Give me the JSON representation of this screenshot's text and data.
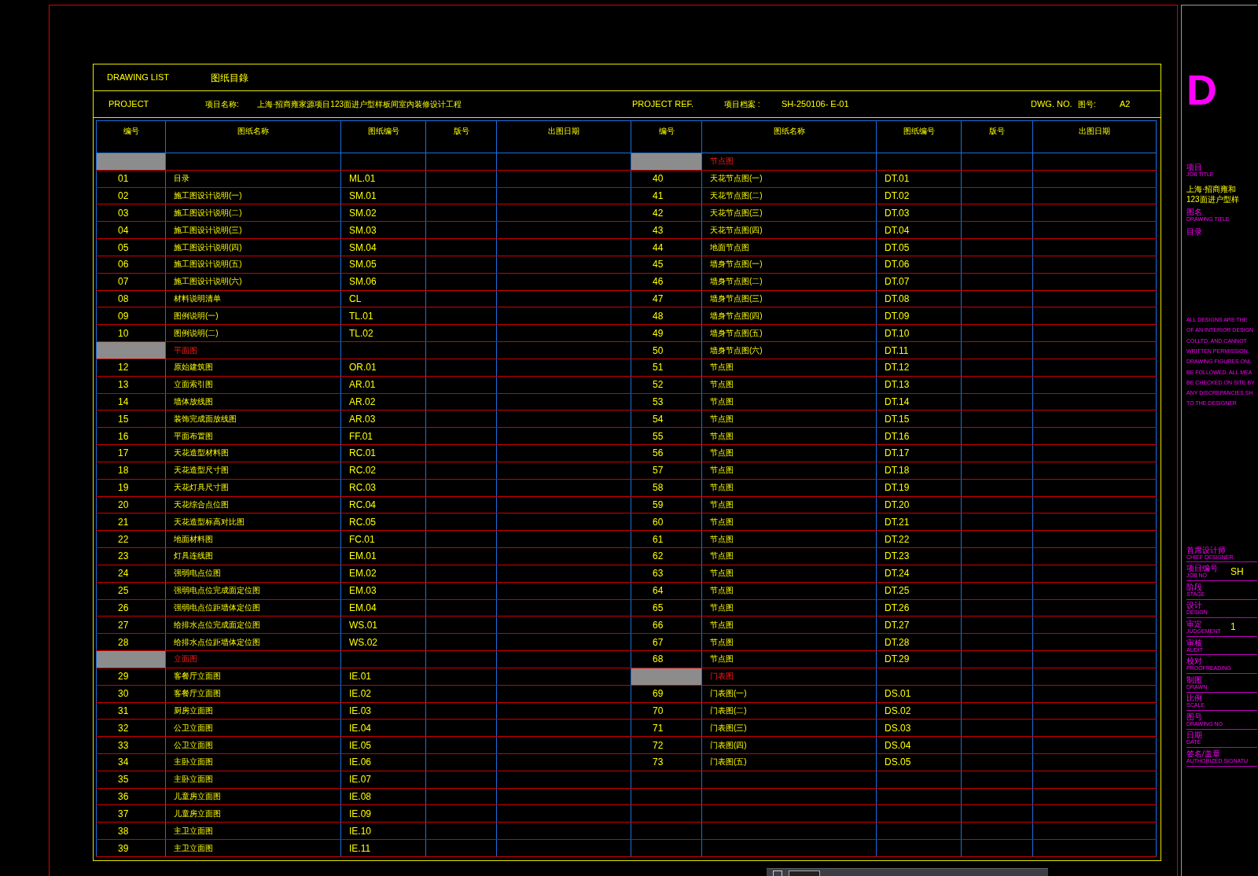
{
  "header": {
    "title_en": "DRAWING LIST",
    "title_cn": "图纸目錄"
  },
  "project": {
    "label_en": "PROJECT",
    "label_cn": "项目名称:",
    "name": "上海·招商雍家源项目123面进户型样板间室内装修设计工程",
    "ref_label_en": "PROJECT REF.",
    "ref_label_cn": "项目档案 :",
    "ref": "SH-250106- E-01",
    "dwg_label_en": "DWG. NO.",
    "dwg_label_cn": "图号:",
    "dwg_no": "A2"
  },
  "left_columns": [
    "编号",
    "图纸名称",
    "图纸编号",
    "版号",
    "出图日期"
  ],
  "right_columns": [
    "编号",
    "图纸名称",
    "图纸编号",
    "版号",
    "出图日期"
  ],
  "left_rows": [
    {
      "kind": "section"
    },
    {
      "kind": "sheet",
      "number": "01",
      "name": "目录",
      "code": "ML.01"
    },
    {
      "kind": "sheet",
      "number": "02",
      "name": "施工图设计说明(一)",
      "code": "SM.01"
    },
    {
      "kind": "sheet",
      "number": "03",
      "name": "施工图设计说明(二)",
      "code": "SM.02"
    },
    {
      "kind": "sheet",
      "number": "04",
      "name": "施工图设计说明(三)",
      "code": "SM.03"
    },
    {
      "kind": "sheet",
      "number": "05",
      "name": "施工图设计说明(四)",
      "code": "SM.04"
    },
    {
      "kind": "sheet",
      "number": "06",
      "name": "施工图设计说明(五)",
      "code": "SM.05"
    },
    {
      "kind": "sheet",
      "number": "07",
      "name": "施工图设计说明(六)",
      "code": "SM.06"
    },
    {
      "kind": "sheet",
      "number": "08",
      "name": "材料说明清单",
      "code": "CL"
    },
    {
      "kind": "sheet",
      "number": "09",
      "name": "图例说明(一)",
      "code": "TL.01"
    },
    {
      "kind": "sheet",
      "number": "10",
      "name": "图例说明(二)",
      "code": "TL.02"
    },
    {
      "kind": "section",
      "name": "平面图"
    },
    {
      "kind": "sheet",
      "number": "12",
      "name": "原始建筑图",
      "code": "OR.01"
    },
    {
      "kind": "sheet",
      "number": "13",
      "name": "立面索引图",
      "code": "AR.01"
    },
    {
      "kind": "sheet",
      "number": "14",
      "name": "墙体放线图",
      "code": "AR.02"
    },
    {
      "kind": "sheet",
      "number": "15",
      "name": "装饰完成面放线图",
      "code": "AR.03"
    },
    {
      "kind": "sheet",
      "number": "16",
      "name": "平面布置图",
      "code": "FF.01"
    },
    {
      "kind": "sheet",
      "number": "17",
      "name": "天花造型材料图",
      "code": "RC.01"
    },
    {
      "kind": "sheet",
      "number": "18",
      "name": "天花造型尺寸图",
      "code": "RC.02"
    },
    {
      "kind": "sheet",
      "number": "19",
      "name": "天花灯具尺寸图",
      "code": "RC.03"
    },
    {
      "kind": "sheet",
      "number": "20",
      "name": "天花综合点位图",
      "code": "RC.04"
    },
    {
      "kind": "sheet",
      "number": "21",
      "name": "天花造型标高对比图",
      "code": "RC.05"
    },
    {
      "kind": "sheet",
      "number": "22",
      "name": "地面材料图",
      "code": "FC.01"
    },
    {
      "kind": "sheet",
      "number": "23",
      "name": "灯具连线图",
      "code": "EM.01"
    },
    {
      "kind": "sheet",
      "number": "24",
      "name": "强弱电点位图",
      "code": "EM.02"
    },
    {
      "kind": "sheet",
      "number": "25",
      "name": "强弱电点位完成面定位图",
      "code": "EM.03"
    },
    {
      "kind": "sheet",
      "number": "26",
      "name": "强弱电点位距墙体定位图",
      "code": "EM.04"
    },
    {
      "kind": "sheet",
      "number": "27",
      "name": "给排水点位完成面定位图",
      "code": "WS.01"
    },
    {
      "kind": "sheet",
      "number": "28",
      "name": "给排水点位距墙体定位图",
      "code": "WS.02"
    },
    {
      "kind": "section",
      "name": "立面图"
    },
    {
      "kind": "sheet",
      "number": "29",
      "name": "客餐厅立面图",
      "code": "IE.01"
    },
    {
      "kind": "sheet",
      "number": "30",
      "name": "客餐厅立面图",
      "code": "IE.02"
    },
    {
      "kind": "sheet",
      "number": "31",
      "name": "厨房立面图",
      "code": "IE.03"
    },
    {
      "kind": "sheet",
      "number": "32",
      "name": "公卫立面图",
      "code": "IE.04"
    },
    {
      "kind": "sheet",
      "number": "33",
      "name": "公卫立面图",
      "code": "IE.05"
    },
    {
      "kind": "sheet",
      "number": "34",
      "name": "主卧立面图",
      "code": "IE.06"
    },
    {
      "kind": "sheet",
      "number": "35",
      "name": "主卧立面图",
      "code": "IE.07"
    },
    {
      "kind": "sheet",
      "number": "36",
      "name": "儿童房立面图",
      "code": "IE.08"
    },
    {
      "kind": "sheet",
      "number": "37",
      "name": "儿童房立面图",
      "code": "IE.09"
    },
    {
      "kind": "sheet",
      "number": "38",
      "name": "主卫立面图",
      "code": "IE.10"
    },
    {
      "kind": "sheet",
      "number": "39",
      "name": "主卫立面图",
      "code": "IE.11"
    }
  ],
  "right_rows": [
    {
      "kind": "section",
      "name": "节点图"
    },
    {
      "kind": "sheet",
      "number": "40",
      "name": "天花节点图(一)",
      "code": "DT.01"
    },
    {
      "kind": "sheet",
      "number": "41",
      "name": "天花节点图(二)",
      "code": "DT.02"
    },
    {
      "kind": "sheet",
      "number": "42",
      "name": "天花节点图(三)",
      "code": "DT.03"
    },
    {
      "kind": "sheet",
      "number": "43",
      "name": "天花节点图(四)",
      "code": "DT.04"
    },
    {
      "kind": "sheet",
      "number": "44",
      "name": "地面节点图",
      "code": "DT.05"
    },
    {
      "kind": "sheet",
      "number": "45",
      "name": "墙身节点图(一)",
      "code": "DT.06"
    },
    {
      "kind": "sheet",
      "number": "46",
      "name": "墙身节点图(二)",
      "code": "DT.07"
    },
    {
      "kind": "sheet",
      "number": "47",
      "name": "墙身节点图(三)",
      "code": "DT.08"
    },
    {
      "kind": "sheet",
      "number": "48",
      "name": "墙身节点图(四)",
      "code": "DT.09"
    },
    {
      "kind": "sheet",
      "number": "49",
      "name": "墙身节点图(五)",
      "code": "DT.10"
    },
    {
      "kind": "sheet",
      "number": "50",
      "name": "墙身节点图(六)",
      "code": "DT.11"
    },
    {
      "kind": "sheet",
      "number": "51",
      "name": "节点图",
      "code": "DT.12"
    },
    {
      "kind": "sheet",
      "number": "52",
      "name": "节点图",
      "code": "DT.13"
    },
    {
      "kind": "sheet",
      "number": "53",
      "name": "节点图",
      "code": "DT.14"
    },
    {
      "kind": "sheet",
      "number": "54",
      "name": "节点图",
      "code": "DT.15"
    },
    {
      "kind": "sheet",
      "number": "55",
      "name": "节点图",
      "code": "DT.16"
    },
    {
      "kind": "sheet",
      "number": "56",
      "name": "节点图",
      "code": "DT.17"
    },
    {
      "kind": "sheet",
      "number": "57",
      "name": "节点图",
      "code": "DT.18"
    },
    {
      "kind": "sheet",
      "number": "58",
      "name": "节点图",
      "code": "DT.19"
    },
    {
      "kind": "sheet",
      "number": "59",
      "name": "节点图",
      "code": "DT.20"
    },
    {
      "kind": "sheet",
      "number": "60",
      "name": "节点图",
      "code": "DT.21"
    },
    {
      "kind": "sheet",
      "number": "61",
      "name": "节点图",
      "code": "DT.22"
    },
    {
      "kind": "sheet",
      "number": "62",
      "name": "节点图",
      "code": "DT.23"
    },
    {
      "kind": "sheet",
      "number": "63",
      "name": "节点图",
      "code": "DT.24"
    },
    {
      "kind": "sheet",
      "number": "64",
      "name": "节点图",
      "code": "DT.25"
    },
    {
      "kind": "sheet",
      "number": "65",
      "name": "节点图",
      "code": "DT.26"
    },
    {
      "kind": "sheet",
      "number": "66",
      "name": "节点图",
      "code": "DT.27"
    },
    {
      "kind": "sheet",
      "number": "67",
      "name": "节点图",
      "code": "DT.28"
    },
    {
      "kind": "sheet",
      "number": "68",
      "name": "节点图",
      "code": "DT.29"
    },
    {
      "kind": "section",
      "name": "门表图"
    },
    {
      "kind": "sheet",
      "number": "69",
      "name": "门表图(一)",
      "code": "DS.01"
    },
    {
      "kind": "sheet",
      "number": "70",
      "name": "门表图(二)",
      "code": "DS.02"
    },
    {
      "kind": "sheet",
      "number": "71",
      "name": "门表图(三)",
      "code": "DS.03"
    },
    {
      "kind": "sheet",
      "number": "72",
      "name": "门表图(四)",
      "code": "DS.04"
    },
    {
      "kind": "sheet",
      "number": "73",
      "name": "门表图(五)",
      "code": "DS.05"
    }
  ],
  "title_block": {
    "logo": "D",
    "job_label_cn": "项目",
    "job_label_en": "JOB TITLE",
    "job_lines": [
      "上海·招商雍和",
      "123面进户型样"
    ],
    "title_label_cn": "图名",
    "title_label_en": "DRAWING TITLE",
    "title_value": "目录",
    "notes": [
      "ALL DESIGNS ARE THE",
      "OF AN INTERIOR DESIGN",
      "COLLTD. AND CANNOT",
      "WRITTEN PERMISSION.",
      "DRAWING FIGURES ONL",
      "BE FOLLOWED. ALL MEA",
      "BE CHECKED ON SITE BY",
      "ANY DISCREPANCIES SH",
      "TO THE DESIGNER"
    ],
    "fields": [
      {
        "cn": "首席设计师",
        "en": "CHIEF DESIGNER"
      },
      {
        "cn": "项目编号",
        "en": "JOB NO",
        "value": "SH"
      },
      {
        "cn": "阶段",
        "en": "STAGE"
      },
      {
        "cn": "设计",
        "en": "DESIGN"
      },
      {
        "cn": "审定",
        "en": "JUDGEMENT",
        "value": "1"
      },
      {
        "cn": "审核",
        "en": "AUDIT"
      },
      {
        "cn": "校对",
        "en": "PROOFREADING"
      },
      {
        "cn": "制图",
        "en": "DRAWN"
      },
      {
        "cn": "比例",
        "en": "SCALE"
      },
      {
        "cn": "图号",
        "en": "DRAWING NO"
      },
      {
        "cn": "日期",
        "en": "DATE"
      },
      {
        "cn": "签名/盖章",
        "en": "AUTHORIZED SIGNATU"
      }
    ]
  }
}
